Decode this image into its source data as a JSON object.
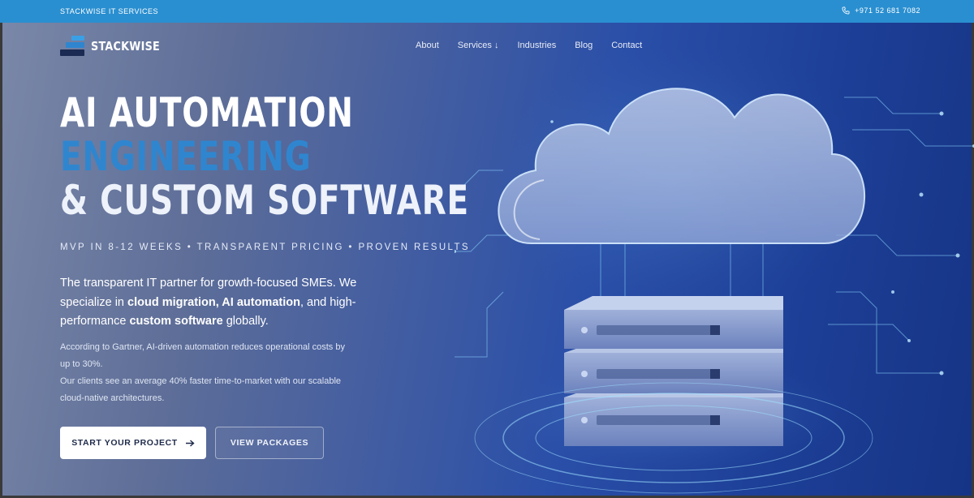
{
  "topbar": {
    "brand": "STACKWISE IT SERVICES",
    "phone": "+971 52 681 7082",
    "phone_icon": "phone-icon"
  },
  "logo": {
    "name": "STACKWISE"
  },
  "nav": {
    "items": [
      "About",
      "Services ↓",
      "Industries",
      "Blog",
      "Contact"
    ]
  },
  "hero": {
    "pre_label": "",
    "title_line1": "AI AUTOMATION",
    "title_line2": "ENGINEERING",
    "title_line3": "& CUSTOM SOFTWARE",
    "tagline": "MVP IN 8-12 WEEKS • TRANSPARENT PRICING • PROVEN RESULTS",
    "intro_part1": "The transparent IT partner for growth-focused SMEs. We specialize in ",
    "intro_bold1": "cloud migration, AI automation",
    "intro_part2": ", and high-performance ",
    "intro_bold2": "custom software",
    "intro_part3": " globally.",
    "stat1": "According to Gartner, AI-driven automation reduces operational costs by up to 30%.",
    "stat2": "Our clients see an average 40% faster time-to-market with our scalable cloud-native architectures.",
    "primary_button": "START YOUR PROJECT",
    "primary_button_icon": "arrow-right-icon",
    "secondary_button": "VIEW PACKAGES"
  },
  "colors": {
    "topbar": "#2a8fd0",
    "accent_title": "#2f86cf",
    "button_bg": "#ffffff",
    "button_text": "#1e2a4a"
  },
  "illustration": {
    "cloud_icon": "cloud-icon",
    "server_icon": "server-stack-icon"
  }
}
